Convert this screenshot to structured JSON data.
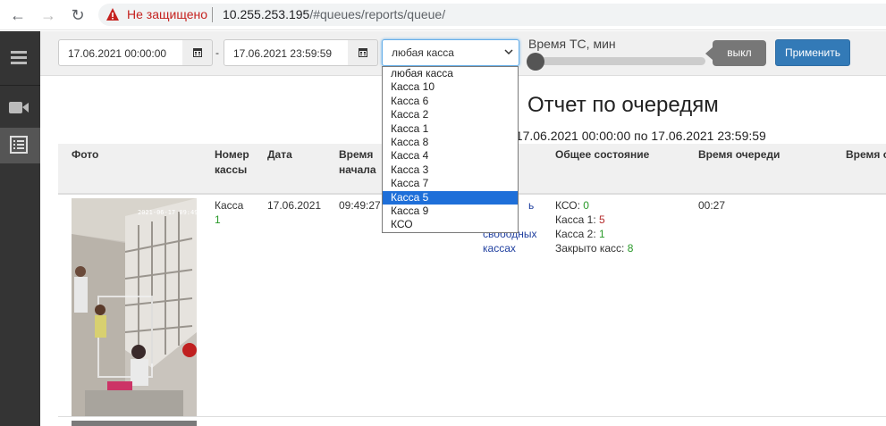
{
  "browser": {
    "not_secure_label": "Не защищено",
    "url_host": "10.255.253.195",
    "url_path": "/#queues/reports/queue/"
  },
  "sidebar": {
    "items": [
      {
        "icon": "menu-icon"
      },
      {
        "icon": "video-camera-icon"
      },
      {
        "icon": "report-list-icon",
        "active": true
      }
    ]
  },
  "filters": {
    "date_from": "17.06.2021 00:00:00",
    "date_separator": "-",
    "date_to": "17.06.2021 23:59:59",
    "register_select": "любая касса",
    "register_options": [
      "любая касса",
      "Касса 10",
      "Касса 6",
      "Касса 2",
      "Касса 1",
      "Касса 8",
      "Касса 4",
      "Касса 3",
      "Касса 7",
      "Касса 5",
      "Касса 9",
      "КСО"
    ],
    "highlighted_option": "Касса 5",
    "slider_label": "Время ТС, мин",
    "slider_value": 0,
    "toggle_label": "выкл",
    "apply_label": "Применить"
  },
  "report": {
    "title": "Отчет по очередям",
    "period_text": ": 17.06.2021 00:00:00 по 17.06.2021 23:59:59",
    "columns": [
      "Фото",
      "Номер кассы",
      "Дата",
      "Время начала",
      "Общее состояние",
      "Время очереди",
      "Время о"
    ],
    "rows": [
      {
        "register_label": "Касса",
        "register_number": "1",
        "date": "17.06.2021",
        "start_time": "09:49:27",
        "message_fragment": [
          "ь",
          "свободных",
          "кассах"
        ],
        "state": [
          {
            "label": "КСО:",
            "value": "0",
            "color": "green"
          },
          {
            "label": "Касса 1:",
            "value": "5",
            "color": "red"
          },
          {
            "label": "Касса 2:",
            "value": "1",
            "color": "green"
          },
          {
            "label": "Закрыто касс:",
            "value": "8",
            "color": "green"
          }
        ],
        "queue_time": "00:27"
      }
    ]
  },
  "colors": {
    "sidebar": "#343434",
    "primary_button": "#337ab7",
    "selected_option": "#1e6fd9"
  }
}
